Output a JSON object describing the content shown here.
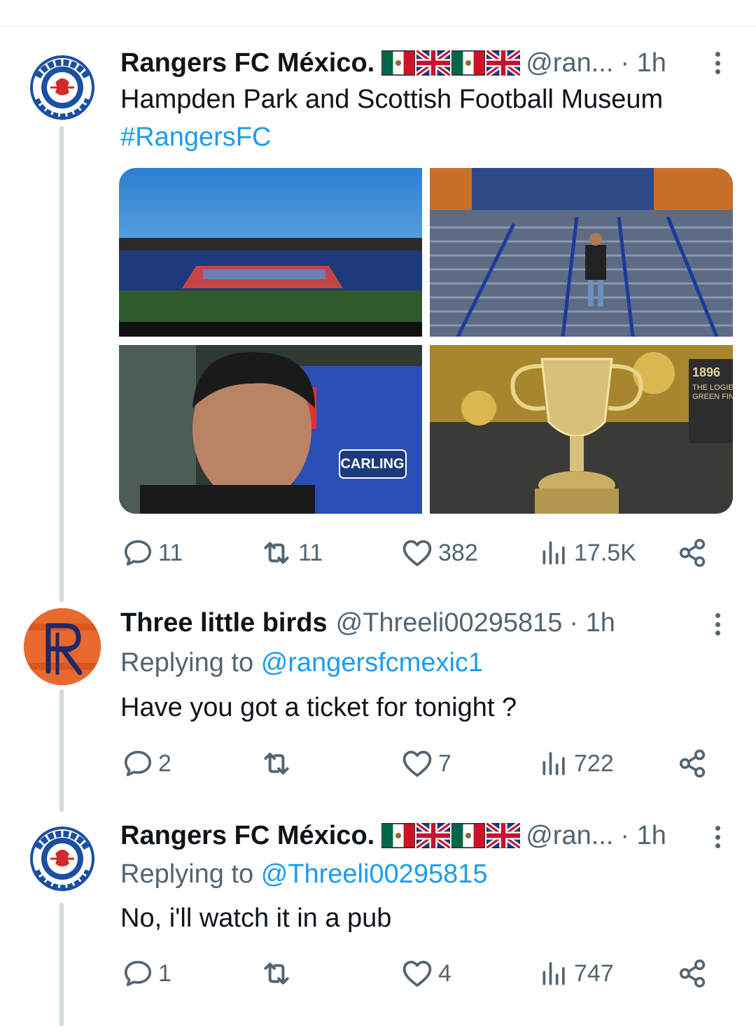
{
  "tweets": [
    {
      "name": "Rangers FC México.",
      "handle": "@ran...",
      "time": "· 1h",
      "text": "Hampden Park and Scottish Football Museum",
      "hashtag": "#RangersFC",
      "media": {
        "img1": "Hampden Park stadium stands",
        "img2": "Man on stadium stairs",
        "img3": "Selfie with Rangers jersey",
        "img3_text": "CARLING",
        "img4": "Scottish Cup trophy",
        "img4_text_1": "1896",
        "img4_text_2": "THE LOGIE",
        "img4_text_3": "GREEN FINA"
      },
      "replies": "11",
      "retweets": "11",
      "likes": "382",
      "views": "17.5K"
    },
    {
      "name": "Three little birds",
      "handle": "@Threeli00295815",
      "time": "· 1h",
      "replying_prefix": "Replying to",
      "replying_to": "@rangersfcmexic1",
      "text": "Have you got a ticket for tonight ?",
      "replies": "2",
      "retweets": "",
      "likes": "7",
      "views": "722"
    },
    {
      "name": "Rangers FC México.",
      "handle": "@ran...",
      "time": "· 1h",
      "replying_prefix": "Replying to",
      "replying_to": "@Threeli00295815",
      "text": "No, i'll watch it in a pub",
      "replies": "1",
      "retweets": "",
      "likes": "4",
      "views": "747"
    }
  ],
  "icons": {
    "reply": "reply-icon",
    "retweet": "retweet-icon",
    "like": "heart-icon",
    "views": "views-icon",
    "share": "share-icon",
    "more": "more-icon",
    "flag_mx": "mexico-flag-icon",
    "flag_uk": "uk-flag-icon"
  },
  "colors": {
    "link": "#1d9bf0",
    "muted": "#536471",
    "text": "#0f1419",
    "rangers_blue": "#1b4fa3",
    "rangers_red": "#d12b2b"
  }
}
